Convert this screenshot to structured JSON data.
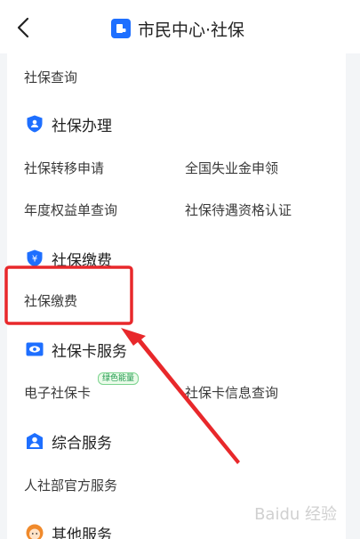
{
  "header": {
    "title": "市民中心·社保",
    "back_icon": "chevron-left-icon",
    "title_icon": "id-card-icon"
  },
  "top_item": "社保查询",
  "sections": [
    {
      "title": "社保办理",
      "icon": "shield-icon",
      "items": [
        "社保转移申请",
        "全国失业金申领",
        "年度权益单查询",
        "社保待遇资格认证"
      ]
    },
    {
      "title": "社保缴费",
      "icon": "yuan-shield-icon",
      "items": [
        "社保缴费"
      ]
    },
    {
      "title": "社保卡服务",
      "icon": "eye-card-icon",
      "items": [
        "电子社保卡",
        "社保卡信息查询"
      ],
      "badge": "绿色能量"
    },
    {
      "title": "综合服务",
      "icon": "person-icon",
      "items": [
        "人社部官方服务"
      ]
    },
    {
      "title": "其他服务",
      "icon": "cartoon-face-icon",
      "items": []
    }
  ],
  "colors": {
    "accent": "#1e6fff",
    "annotation_red": "#e8282b",
    "badge_green": "#1f9a4d"
  },
  "watermark": "Baidu 经验"
}
